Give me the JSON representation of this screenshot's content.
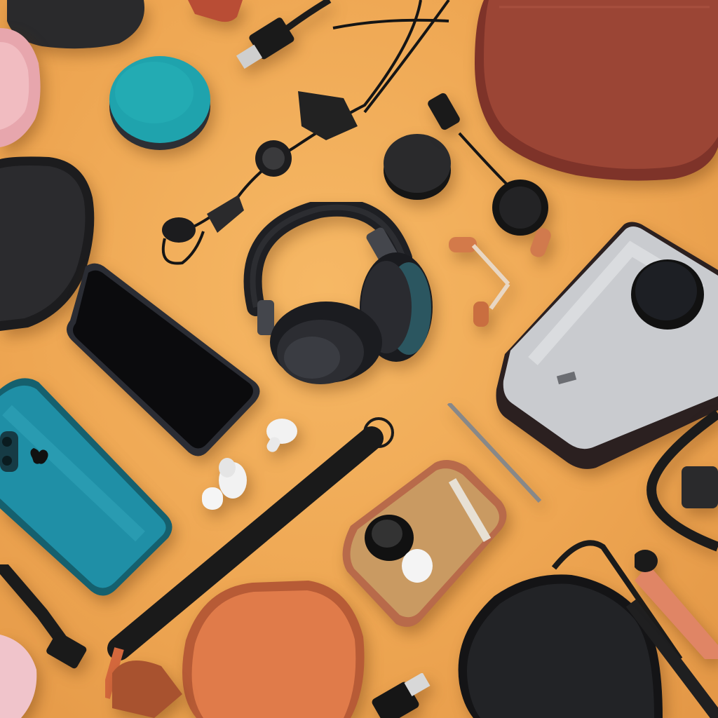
{
  "scene": {
    "background_color": "#eea652",
    "objects": [
      {
        "name": "headphones",
        "color": "#1e1f23"
      },
      {
        "name": "smartphone-black",
        "color": "#0e0e10"
      },
      {
        "name": "smartphone-teal",
        "color": "#1f8fa6",
        "logo": "apple-logo-icon"
      },
      {
        "name": "portable-speaker-silver",
        "color": "#c9cbcf"
      },
      {
        "name": "leather-pouch-red",
        "color": "#9b4535"
      },
      {
        "name": "earbuds-white",
        "color": "#f2f2f2"
      },
      {
        "name": "earbud-case-tan",
        "color": "#c99a62"
      },
      {
        "name": "pouch-orange",
        "color": "#e07b4a"
      },
      {
        "name": "case-black",
        "color": "#222326"
      },
      {
        "name": "lanyard-strap",
        "color": "#1a1a1a"
      },
      {
        "name": "puck-teal",
        "color": "#1fa3ad"
      },
      {
        "name": "puck-black",
        "color": "#222"
      },
      {
        "name": "usb-cable",
        "color": "#1b1b1b"
      }
    ]
  }
}
